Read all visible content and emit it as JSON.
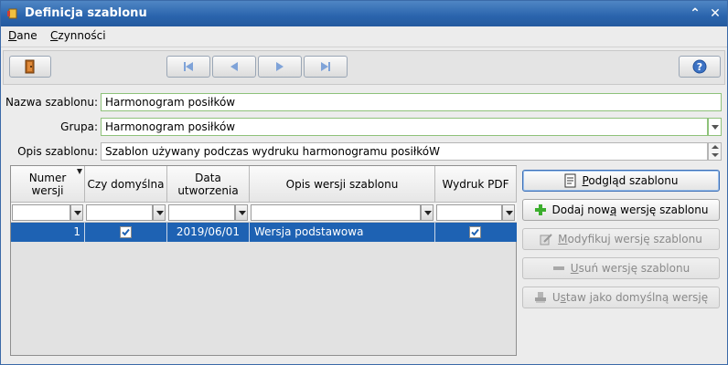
{
  "window": {
    "title": "Definicja szablonu"
  },
  "menu": [
    {
      "key": "D",
      "rest": "ane"
    },
    {
      "key": "C",
      "rest": "zynności"
    }
  ],
  "form": {
    "nazwa_label": "Nazwa szablonu:",
    "nazwa_value": "Harmonogram posiłków",
    "grupa_label": "Grupa:",
    "grupa_value": "Harmonogram posiłków",
    "opis_label": "Opis szablonu:",
    "opis_value": "Szablon używany podczas wydruku harmonogramu posiłkóW"
  },
  "grid": {
    "headers": {
      "numer": "Numer\nwersji",
      "domyslna": "Czy domyślna",
      "data": "Data\nutworzenia",
      "opis": "Opis wersji szablonu",
      "pdf": "Wydruk PDF"
    },
    "rows": [
      {
        "numer": "1",
        "domyslna": true,
        "data": "2019/06/01",
        "opis": "Wersja podstawowa",
        "pdf": true
      }
    ]
  },
  "actions": {
    "podglad": {
      "pre": "",
      "key": "P",
      "post": "odgląd szablonu"
    },
    "dodaj": {
      "pre": "Dodaj now",
      "key": "ą",
      "post": " wersję szablonu"
    },
    "modyfikuj": {
      "pre": "",
      "key": "M",
      "post": "odyfikuj wersję szablonu"
    },
    "usun": {
      "pre": "",
      "key": "U",
      "post": "suń wersję szablonu"
    },
    "ustaw": {
      "pre": "U",
      "key": "s",
      "post": "taw jako domyślną wersję"
    }
  },
  "colors": {
    "title_bg": "#2a64ad",
    "selection": "#1e62b3",
    "valid_border": "#8ec27a"
  }
}
